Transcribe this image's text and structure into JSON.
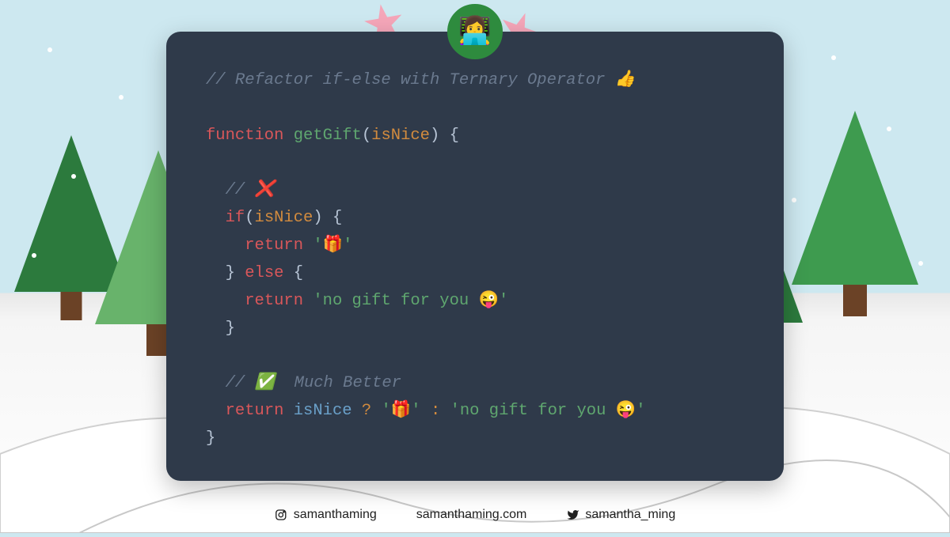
{
  "code": {
    "title_comment": "// Refactor if-else with Ternary Operator 👍",
    "kw_function": "function",
    "fn_name": "getGift",
    "param": "isNice",
    "open_paren": "(",
    "close_paren": ")",
    "open_brace": "{",
    "close_brace": "}",
    "bad_comment": "// ❌",
    "kw_if": "if",
    "kw_return": "return",
    "str_gift": "'🎁'",
    "kw_else": "else",
    "str_nogift": "'no gift for you 😜'",
    "good_comment": "// ✅  Much Better",
    "op_ternary_q": "?",
    "op_ternary_c": ":"
  },
  "footer": {
    "instagram": "samanthaming",
    "website": "samanthaming.com",
    "twitter": "samantha_ming"
  },
  "avatar_emoji": "👩‍💻"
}
